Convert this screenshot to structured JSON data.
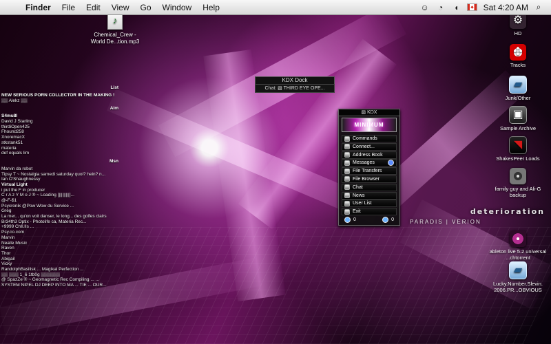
{
  "menubar": {
    "app": "Finder",
    "items": [
      "File",
      "Edit",
      "View",
      "Go",
      "Window",
      "Help"
    ],
    "clock": "Sat 4:20 AM",
    "icons": [
      "apple-icon",
      "alien-icon",
      "wifi-icon",
      "volume-icon",
      "flag-icon",
      "spotlight-icon"
    ]
  },
  "desktop_file": {
    "name_line_1": "Chemical_Crew -",
    "name_line_2": "World De...tion.mp3",
    "icon": "mp3-file-icon"
  },
  "left_panel": {
    "list_title": "List",
    "list_items": [
      "NEW SERIOUS PORN COLLECTOR IN THE MAKING !",
      "▒▒ Alekz ▒▒"
    ],
    "aim_title": "Aim",
    "aim_items": [
      "S4mu8l",
      "David J Starling",
      "thirdiOpen425",
      "Fhound258",
      "XnoremacX",
      "stkstank51",
      "materia",
      "def equals lim"
    ],
    "msn_title": "Msn",
    "msn_items": [
      "Marvin da robot",
      "Tipsy T ~ Nostalgia samedi saturday quoi? hein? n...",
      "Ian O'Shaughnessy",
      "Virtual Light",
      "i put the F in producer",
      "C r A z Y M o J ® ~ Loading [|||||||||]...",
      "@-F-$1",
      "Psycronik @Pow Wow du Service ...",
      "Greg",
      "La mer... qu'on voit danser, le long... des golfes clairs",
      "Br34th3 Optix - Photolife ca, Materia Rec...",
      "+9999 ChIl.lIs ...",
      "Psy.co.com",
      "Marvin",
      "Nealle Music",
      "Raven",
      "Thor",
      "Abigail",
      "Vicky",
      "RandolphBasilisk ... Magikal Perfection ...",
      "▒▒ ▒▒▒ 1_6 1tb0g ▒▒▒▒▒▒",
      "@ SpazZe ® ~ Geomagnetic Rec Compiling ... ...",
      "SYSTEM NIPEL DJ DEEP INTO MA ... TIE ... OUR..."
    ]
  },
  "kdx_dock": {
    "title": "KDX Dock",
    "chat": "Chat: ▧ THIRD EYE OPE..."
  },
  "kdx_window": {
    "title": "▧ KDX",
    "banner": "MINIMUM",
    "items": [
      "Commands",
      "Connect...",
      "Address Book",
      "Messages",
      "File Transfers",
      "File Browser",
      "Chat",
      "News",
      "User List",
      "Exit"
    ],
    "footer_left": "0",
    "footer_right": "0",
    "accent": "#b51eb1"
  },
  "right_icons": [
    {
      "label": "HD",
      "icon": "gear-icon"
    },
    {
      "label": "Tracks",
      "icon": "umbrella-icon"
    },
    {
      "label": "Junk/Other",
      "icon": "folder-icon"
    },
    {
      "label": "Sample Archive",
      "icon": "dark-drive-icon"
    },
    {
      "label": "ShakesPeer Loads",
      "icon": "shakespeer-icon"
    },
    {
      "label": "family guy and Ali-G backup",
      "icon": "disk-icon"
    },
    {
      "label": "ableton live 5.2 universal ...chtorrent",
      "icon": "torrent-icon"
    },
    {
      "label": "Lucky.Number.Slevin. 2006.PR...OBVIOUS",
      "icon": "folder-icon"
    }
  ],
  "wallpaper_text": {
    "main": "deterioration",
    "sub": "PARADIS | VERION"
  }
}
